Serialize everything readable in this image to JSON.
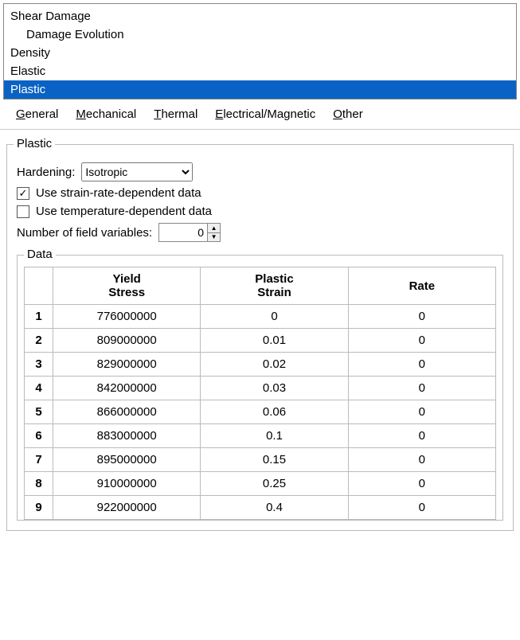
{
  "tree": {
    "items": [
      {
        "label": "Shear Damage",
        "indent": false,
        "selected": false
      },
      {
        "label": "Damage Evolution",
        "indent": true,
        "selected": false
      },
      {
        "label": "Density",
        "indent": false,
        "selected": false
      },
      {
        "label": "Elastic",
        "indent": false,
        "selected": false
      },
      {
        "label": "Plastic",
        "indent": false,
        "selected": true
      }
    ]
  },
  "menu": {
    "general": {
      "accel": "G",
      "rest": "eneral"
    },
    "mechanical": {
      "accel": "M",
      "rest": "echanical"
    },
    "thermal": {
      "accel": "T",
      "rest": "hermal"
    },
    "electrical": {
      "accel": "E",
      "rest": "lectrical/Magnetic"
    },
    "other": {
      "accel": "O",
      "rest": "ther"
    }
  },
  "plastic": {
    "legend": "Plastic",
    "hardening_label": "Hardening:",
    "hardening_value": "Isotropic",
    "strain_rate_checked": true,
    "strain_rate_label": "Use strain-rate-dependent data",
    "temperature_checked": false,
    "temperature_label": "Use temperature-dependent data",
    "field_vars_label": "Number of field variables:",
    "field_vars_value": "0"
  },
  "data": {
    "legend": "Data",
    "headers": {
      "c1": "Yield\nStress",
      "c2": "Plastic\nStrain",
      "c3": "Rate"
    },
    "rows": [
      {
        "n": "1",
        "yield": "776000000",
        "strain": "0",
        "rate": "0"
      },
      {
        "n": "2",
        "yield": "809000000",
        "strain": "0.01",
        "rate": "0"
      },
      {
        "n": "3",
        "yield": "829000000",
        "strain": "0.02",
        "rate": "0"
      },
      {
        "n": "4",
        "yield": "842000000",
        "strain": "0.03",
        "rate": "0"
      },
      {
        "n": "5",
        "yield": "866000000",
        "strain": "0.06",
        "rate": "0"
      },
      {
        "n": "6",
        "yield": "883000000",
        "strain": "0.1",
        "rate": "0"
      },
      {
        "n": "7",
        "yield": "895000000",
        "strain": "0.15",
        "rate": "0"
      },
      {
        "n": "8",
        "yield": "910000000",
        "strain": "0.25",
        "rate": "0"
      },
      {
        "n": "9",
        "yield": "922000000",
        "strain": "0.4",
        "rate": "0"
      }
    ]
  }
}
